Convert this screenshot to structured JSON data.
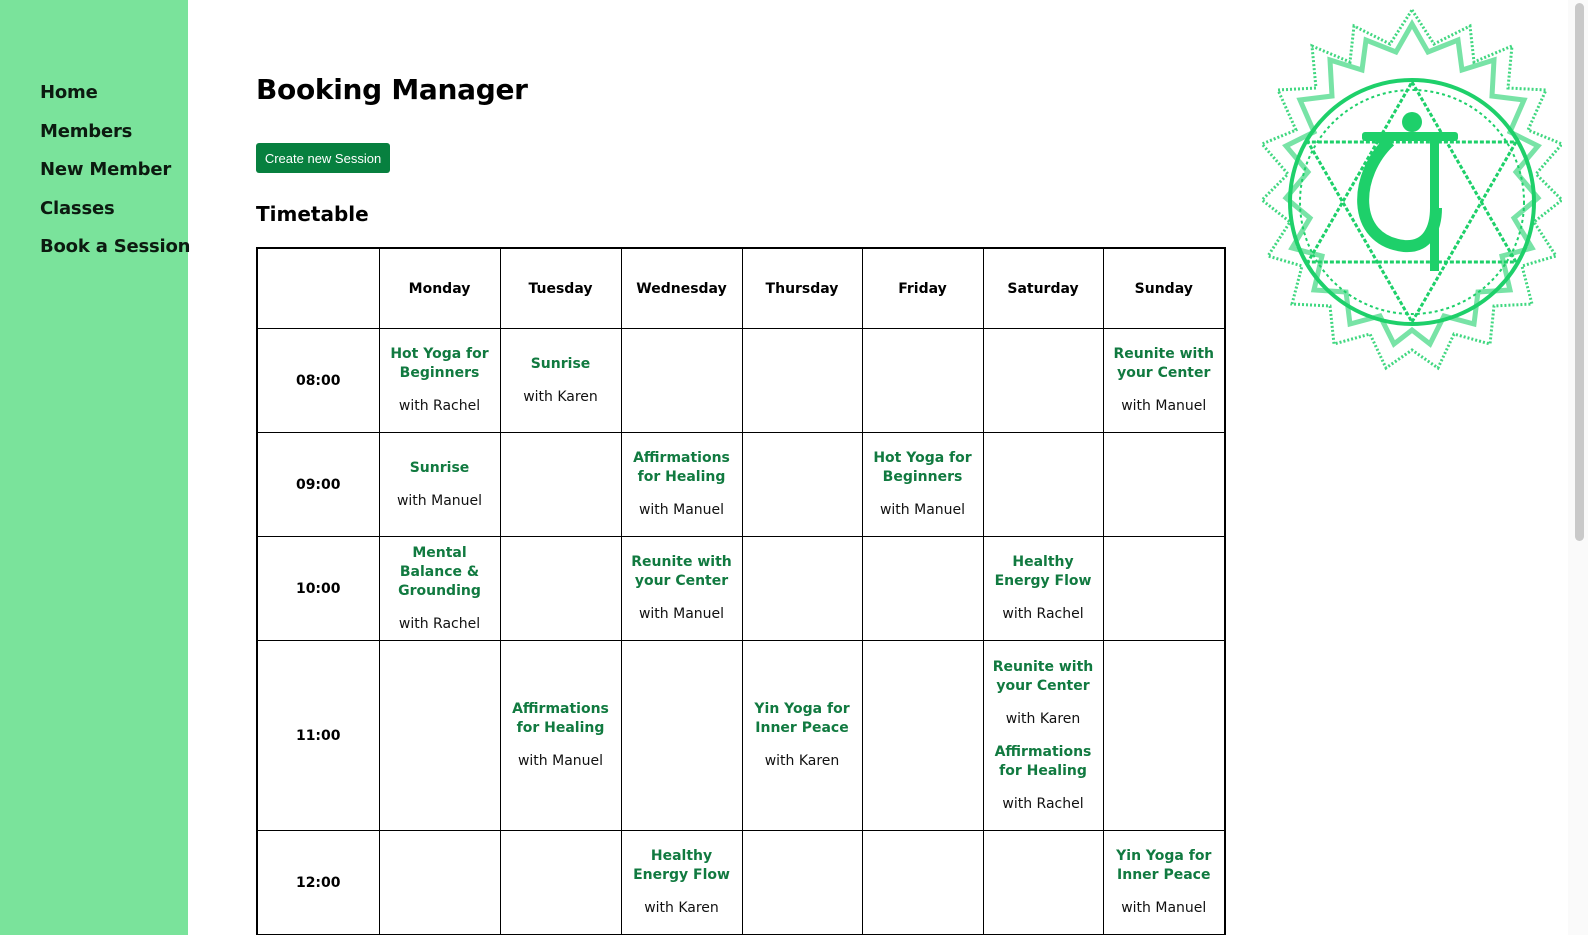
{
  "nav": {
    "items": [
      {
        "label": "Home"
      },
      {
        "label": "Members"
      },
      {
        "label": "New Member"
      },
      {
        "label": "Classes"
      },
      {
        "label": "Book a Session"
      }
    ]
  },
  "page": {
    "title": "Booking Manager",
    "create_button": "Create new Session",
    "subtitle": "Timetable"
  },
  "timetable": {
    "days": [
      "Monday",
      "Tuesday",
      "Wednesday",
      "Thursday",
      "Friday",
      "Saturday",
      "Sunday"
    ],
    "rows": [
      {
        "time": "08:00",
        "cells": [
          [
            {
              "class": "Hot Yoga for Beginners",
              "instructor": "with Rachel"
            }
          ],
          [
            {
              "class": "Sunrise",
              "instructor": "with Karen"
            }
          ],
          [],
          [],
          [],
          [],
          [
            {
              "class": "Reunite with your Center",
              "instructor": "with Manuel"
            }
          ]
        ]
      },
      {
        "time": "09:00",
        "cells": [
          [
            {
              "class": "Sunrise",
              "instructor": "with Manuel"
            }
          ],
          [],
          [
            {
              "class": "Affirmations for Healing",
              "instructor": "with Manuel"
            }
          ],
          [],
          [
            {
              "class": "Hot Yoga for Beginners",
              "instructor": "with Manuel"
            }
          ],
          [],
          []
        ]
      },
      {
        "time": "10:00",
        "cells": [
          [
            {
              "class": "Mental Balance & Grounding",
              "instructor": "with Rachel"
            }
          ],
          [],
          [
            {
              "class": "Reunite with your Center",
              "instructor": "with Manuel"
            }
          ],
          [],
          [],
          [
            {
              "class": "Healthy Energy Flow",
              "instructor": "with Rachel"
            }
          ],
          []
        ]
      },
      {
        "time": "11:00",
        "cells": [
          [],
          [
            {
              "class": "Affirmations for Healing",
              "instructor": "with Manuel"
            }
          ],
          [],
          [
            {
              "class": "Yin Yoga for Inner Peace",
              "instructor": "with Karen"
            }
          ],
          [],
          [
            {
              "class": "Reunite with your Center",
              "instructor": "with Karen"
            },
            {
              "class": "Affirmations for Healing",
              "instructor": "with Rachel"
            }
          ],
          []
        ]
      },
      {
        "time": "12:00",
        "cells": [
          [],
          [],
          [
            {
              "class": "Healthy Energy Flow",
              "instructor": "with Karen"
            }
          ],
          [],
          [],
          [],
          [
            {
              "class": "Yin Yoga for Inner Peace",
              "instructor": "with Manuel"
            }
          ]
        ]
      }
    ]
  },
  "colors": {
    "sidebar": "#7ae39b",
    "accent": "#07803f",
    "class_text": "#117a40",
    "emblem": "#1ed06a"
  },
  "icons": {
    "emblem": "heart-chakra-mandala-icon"
  }
}
